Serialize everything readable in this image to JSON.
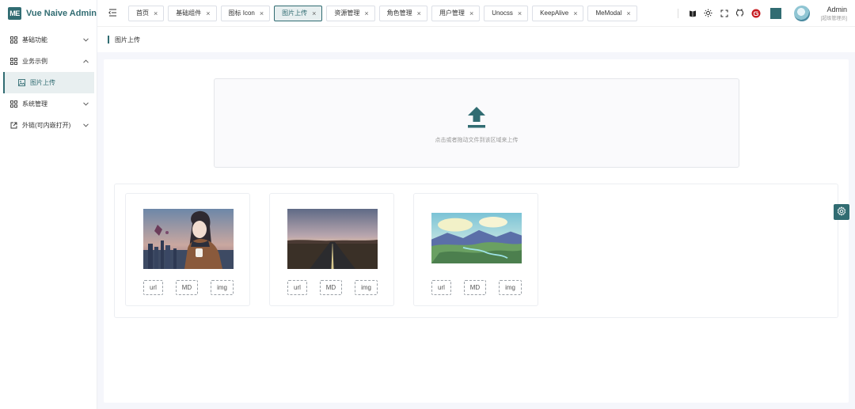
{
  "app": {
    "logo_text": "ME",
    "title": "Vue Naive Admin"
  },
  "sidebar": {
    "items": [
      {
        "label": "基础功能",
        "icon": "grid-icon",
        "arrow": "chevron-down-icon"
      },
      {
        "label": "业务示例",
        "icon": "grid-icon",
        "arrow": "chevron-up-icon"
      },
      {
        "label": "图片上传",
        "icon": "image-icon",
        "active": true
      },
      {
        "label": "系统管理",
        "icon": "grid-icon",
        "arrow": "chevron-down-icon"
      },
      {
        "label": "外链(可内嵌打开)",
        "icon": "external-link-icon",
        "arrow": "chevron-down-icon"
      }
    ]
  },
  "header": {
    "tabs": [
      {
        "label": "首页"
      },
      {
        "label": "基础组件"
      },
      {
        "label": "图标 Icon"
      },
      {
        "label": "图片上传",
        "active": true
      },
      {
        "label": "资源管理"
      },
      {
        "label": "角色管理"
      },
      {
        "label": "用户管理"
      },
      {
        "label": "Unocss"
      },
      {
        "label": "KeepAlive"
      },
      {
        "label": "MeModal"
      }
    ],
    "close_glyph": "×",
    "user": {
      "name": "Admin",
      "role": "[超级管理员]"
    },
    "theme_color": "#316c72"
  },
  "breadcrumb": {
    "current": "图片上传"
  },
  "upload": {
    "hint": "点击或者拖动文件到该区域来上传"
  },
  "gallery": {
    "action_labels": [
      "url",
      "MD",
      "img"
    ],
    "images": [
      {
        "alt": "anime-girl"
      },
      {
        "alt": "road-sunset"
      },
      {
        "alt": "valley-landscape"
      }
    ]
  },
  "colors": {
    "primary": "#316c72",
    "bg": "#f5f6fb"
  }
}
